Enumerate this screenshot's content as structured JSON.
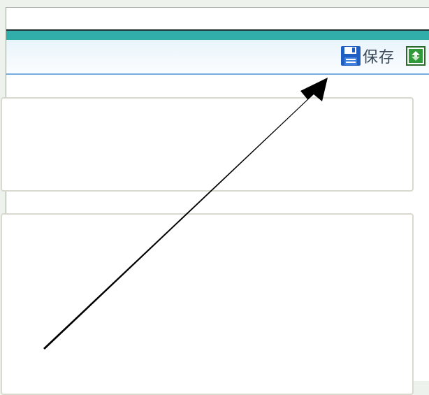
{
  "toolbar": {
    "save_label": "保存",
    "save_icon": "floppy-disk-icon",
    "refresh_icon": "refresh-icon"
  },
  "colors": {
    "teal_strip": "#32aeaa",
    "toolbar_border": "#76aee3",
    "save_icon_blue": "#1f5fc2",
    "refresh_green": "#2e9a3a",
    "annotation_arrow": "#000000"
  },
  "annotation": {
    "type": "arrow",
    "points_to": "save-button"
  }
}
